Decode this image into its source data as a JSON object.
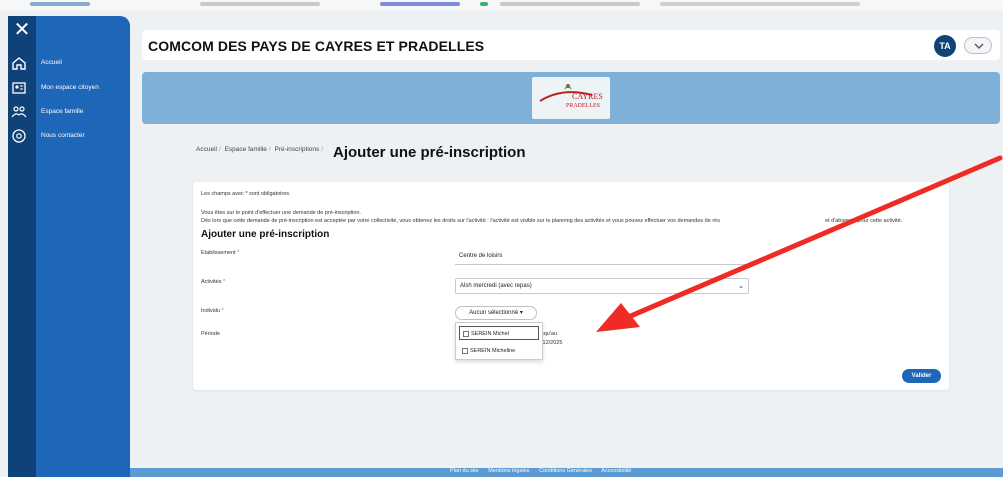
{
  "header": {
    "title": "COMCOM DES PAYS DE CAYRES ET PRADELLES",
    "avatar_initials": "TA"
  },
  "sidebar": {
    "items": [
      {
        "label": "Accueil",
        "icon": "home-icon"
      },
      {
        "label": "Mon espace citoyen",
        "icon": "id-card-icon"
      },
      {
        "label": "Espace famille",
        "icon": "family-icon"
      },
      {
        "label": "Nous contacter",
        "icon": "at-sign-icon"
      }
    ]
  },
  "banner": {
    "logo_text_top": "CAYRES",
    "logo_text_bottom": "PRADELLES"
  },
  "breadcrumb": {
    "items": [
      "Accueil",
      "Espace famille",
      "Pré-inscriptions"
    ],
    "current": "Ajouter une pré-inscription"
  },
  "form": {
    "required_note": "Les champs avec * sont obligatoires.",
    "info_line1": "Vous êtes sur le point d'effectuer une demande de pré-inscription.",
    "info_line2": "Dès lors que cette demande de pré-inscription est acceptée par votre collectivité, vous obtenez les droits sur l'activité : l'activité est visible sur le planning des activités et vous pouvez effectuer vos demandes de rés",
    "info_line2_end": "et d'absence pour cette activité.",
    "section_title": "Ajouter une pré-inscription",
    "fields": {
      "etablissement_label": "Etablissement",
      "etablissement_value": "Centre de loisirs",
      "activites_label": "Activités",
      "activites_value": "Alsh mercredi (avec repas)",
      "individu_label": "Individu",
      "individu_button": "Aucun sélectionné ▾",
      "periode_label": "Période",
      "periode_partial_1": "squ'au",
      "periode_partial_2": "/12/2025"
    },
    "individu_options": [
      "SEREIN Michel",
      "SEREIN Micheline"
    ],
    "submit_label": "Valider"
  },
  "footer": {
    "links": [
      "Plan du site",
      "Mentions légales",
      "Conditions Générales",
      "Accessibilité"
    ]
  },
  "colors": {
    "sidebar_dark": "#10427a",
    "sidebar": "#1d66b8",
    "banner": "#7fb0d8",
    "annotation_arrow": "#ee2b24"
  }
}
